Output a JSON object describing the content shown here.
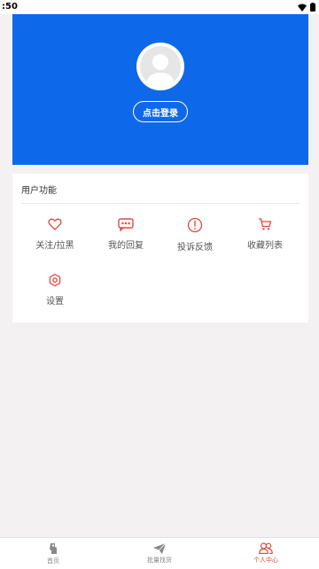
{
  "status_bar": {
    "time": ":50",
    "icons": [
      "wifi-icon",
      "battery-icon"
    ]
  },
  "header": {
    "background_color": "#0e69ea",
    "avatar_icon": "user-icon",
    "login_label": "点击登录"
  },
  "functions": {
    "title": "用户功能",
    "items": [
      {
        "label": "关注/拉黑",
        "icon": "heart-icon"
      },
      {
        "label": "我的回复",
        "icon": "message-icon"
      },
      {
        "label": "投诉反馈",
        "icon": "alert-icon"
      },
      {
        "label": "收藏列表",
        "icon": "cart-icon"
      },
      {
        "label": "设置",
        "icon": "settings-icon"
      }
    ],
    "icon_color": "#e0493a"
  },
  "tabbar": {
    "tabs": [
      {
        "label": "首页",
        "icon": "home-icon",
        "active": false
      },
      {
        "label": "批量找货",
        "icon": "send-icon",
        "active": false
      },
      {
        "label": "个人中心",
        "icon": "users-icon",
        "active": true
      }
    ],
    "active_color": "#e0493a"
  }
}
